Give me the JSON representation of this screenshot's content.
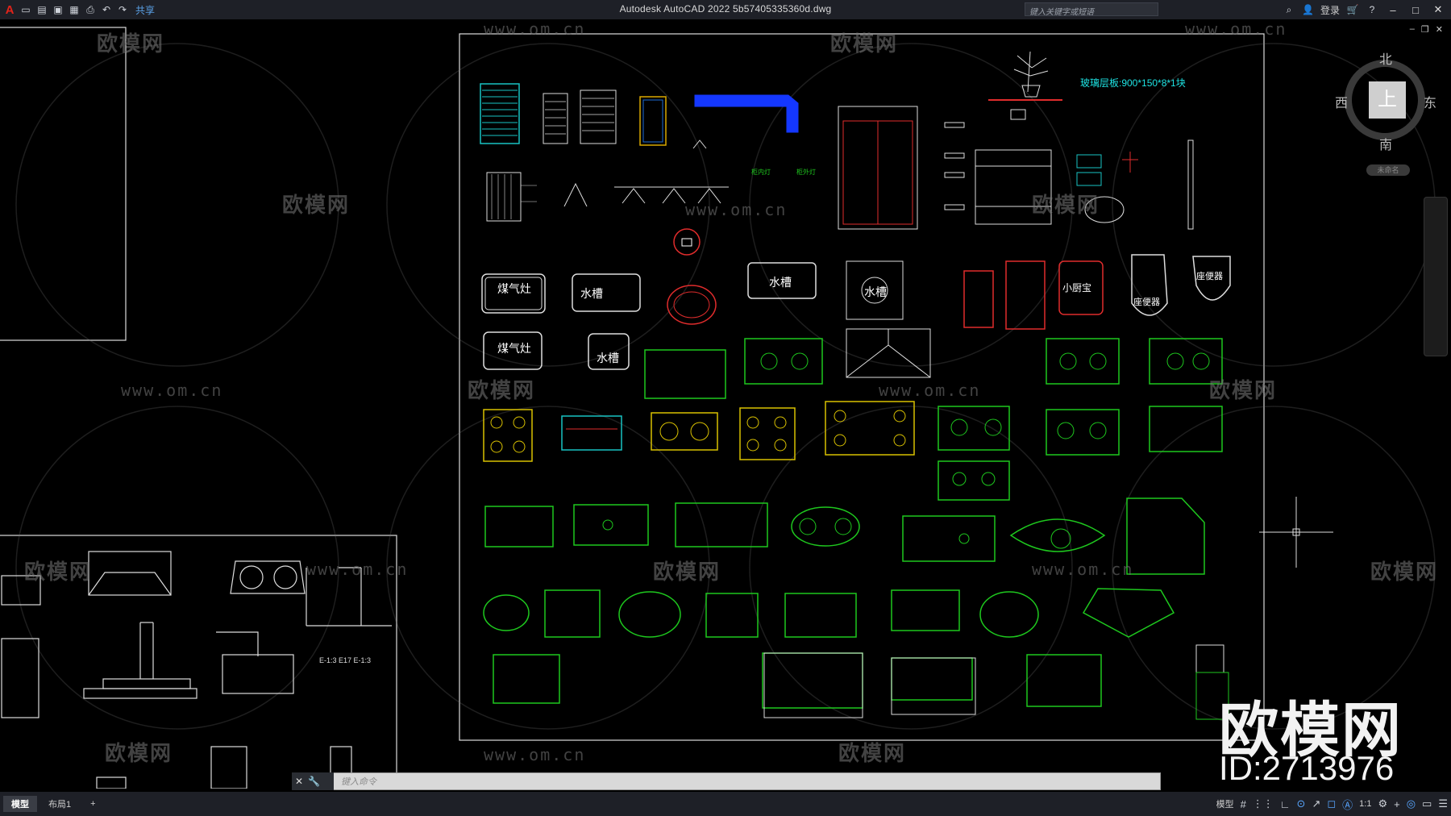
{
  "app": {
    "logo": "A",
    "title": "Autodesk AutoCAD 2022    5b57405335360d.dwg",
    "share_label": "共享",
    "search_placeholder": "键入关键字或短语",
    "login_label": "登录"
  },
  "quick_access": [
    "new-icon",
    "open-icon",
    "save-icon",
    "saveas-icon",
    "plot-icon",
    "undo-icon",
    "redo-icon"
  ],
  "viewcube": {
    "top": "上",
    "north": "北",
    "south": "南",
    "west": "西",
    "east": "东",
    "wcs": "未命名"
  },
  "drawing": {
    "cyan_note": "玻璃层板:900*150*8*1块",
    "labels": [
      "煤气灶",
      "水槽",
      "水槽",
      "水槽",
      "煤气灶",
      "水槽",
      "小厨宝",
      "座便器",
      "座便器"
    ],
    "watermark": "欧模网",
    "watermark_url": "www.om.cn",
    "brand": "欧模网",
    "brand_id": "ID:2713976"
  },
  "command": {
    "prompt": "键入命令"
  },
  "statusbar": {
    "tabs": [
      "模型",
      "布局1"
    ],
    "add": "+",
    "model_label": "模型",
    "scale": "1:1"
  }
}
